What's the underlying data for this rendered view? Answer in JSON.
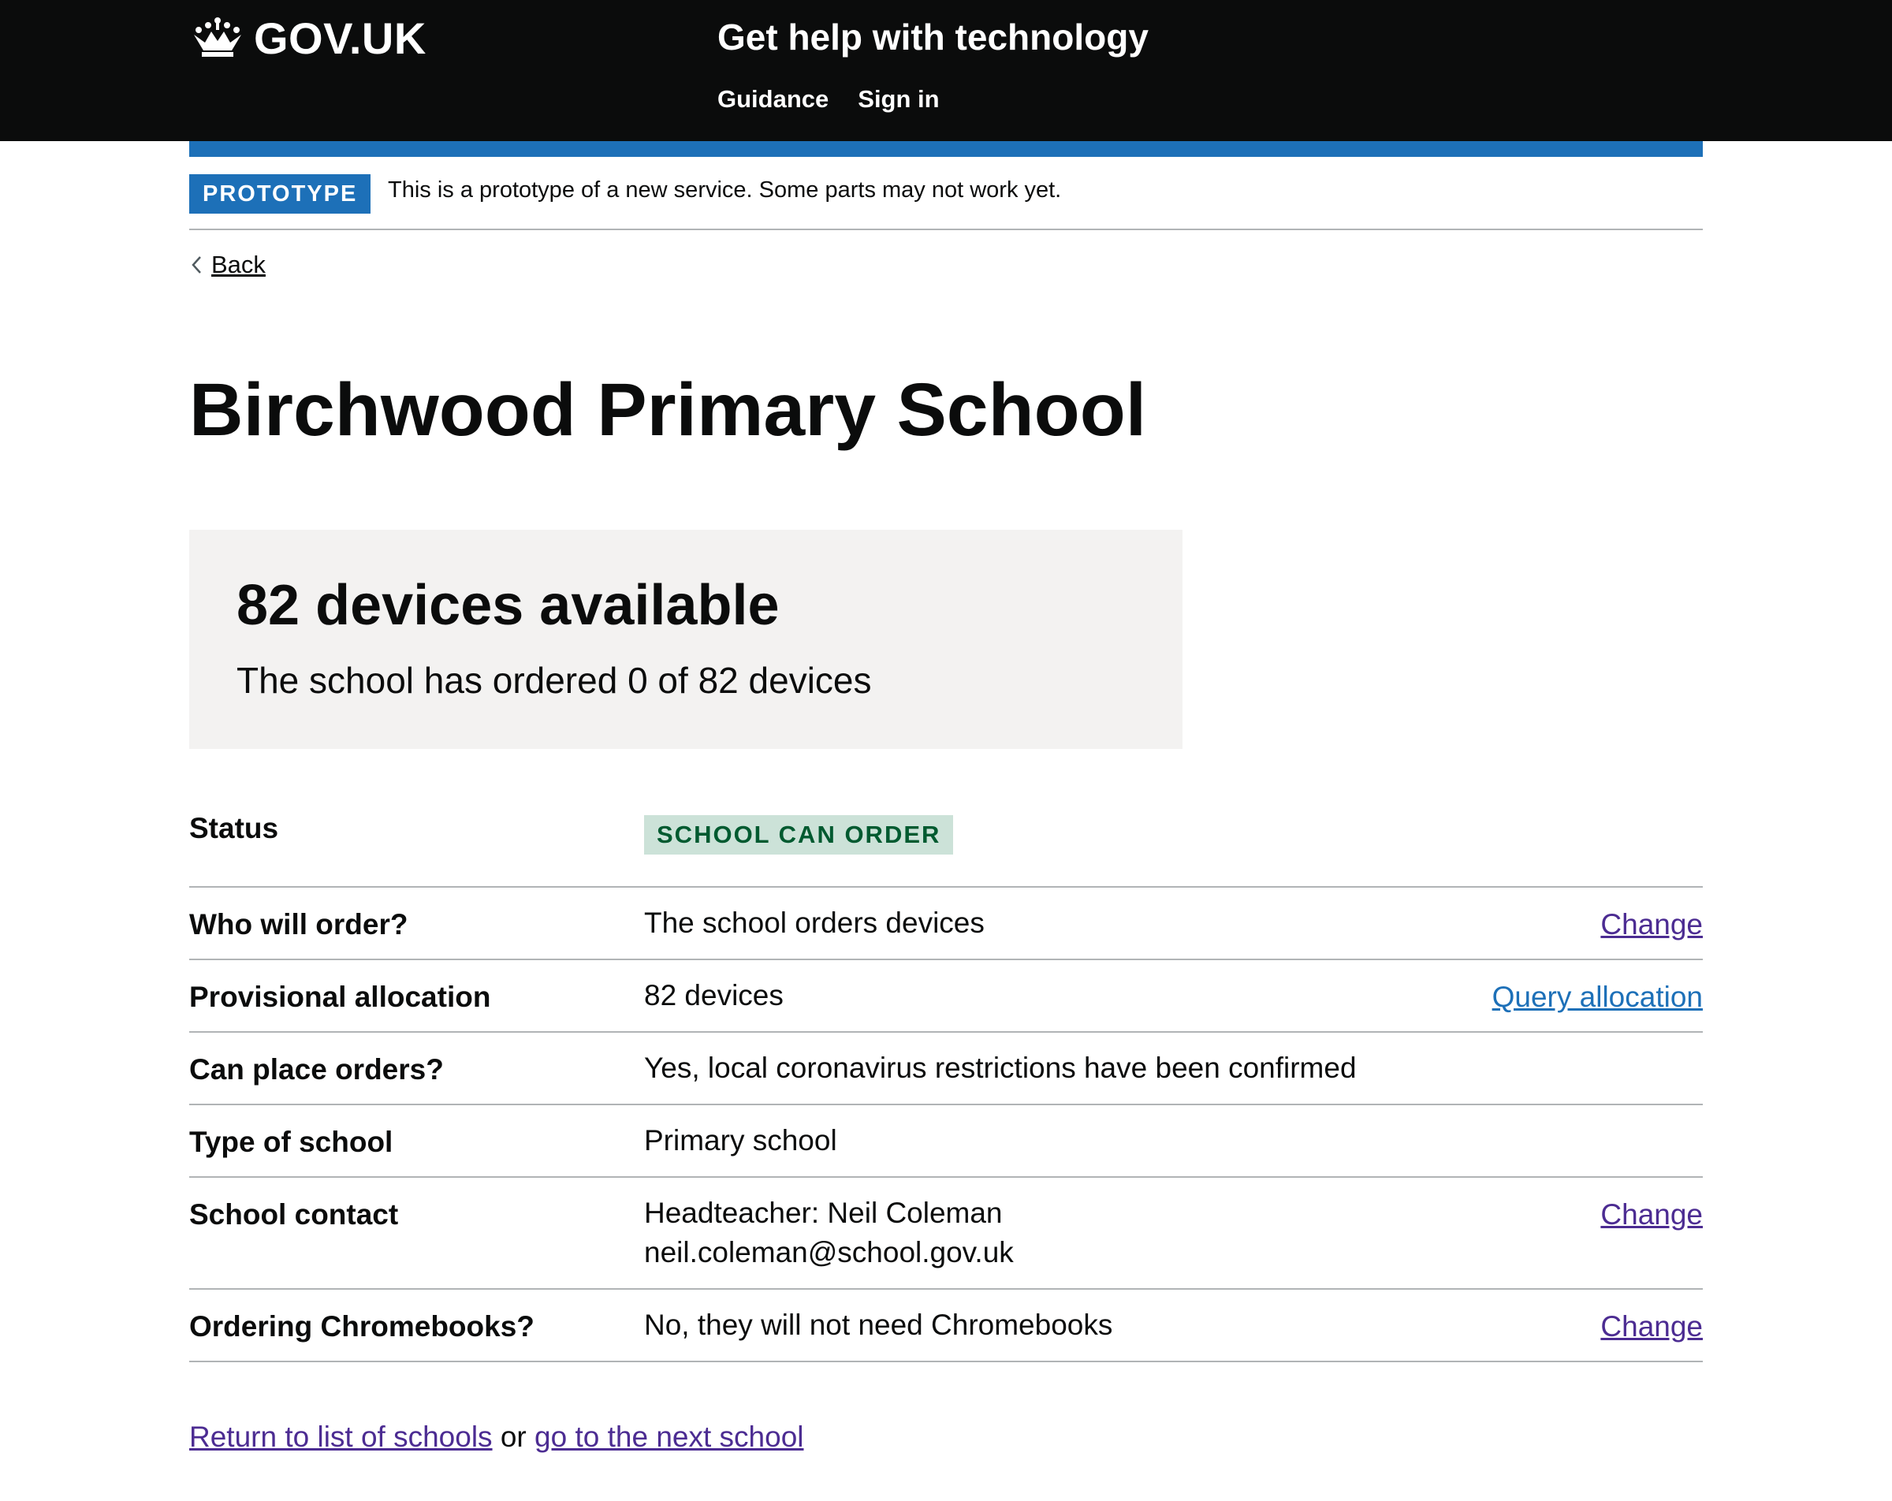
{
  "header": {
    "logo_text": "GOV.UK",
    "service_name": "Get help with technology",
    "nav": [
      "Guidance",
      "Sign in"
    ]
  },
  "phase_banner": {
    "tag": "PROTOTYPE",
    "text": "This is a prototype of a new service. Some parts may not work yet."
  },
  "back_link": "Back",
  "page_title": "Birchwood Primary School",
  "panel": {
    "heading": "82 devices available",
    "body": "The school has ordered 0 of 82 devices"
  },
  "summary": [
    {
      "key": "Status",
      "value": "SCHOOL CAN ORDER",
      "tag": true
    },
    {
      "key": "Who will order?",
      "value": "The school orders devices",
      "action": "Change"
    },
    {
      "key": "Provisional allocation",
      "value": "82 devices",
      "action": "Query allocation"
    },
    {
      "key": "Can place orders?",
      "value": "Yes, local coronavirus restrictions have been confirmed"
    },
    {
      "key": "Type of school",
      "value": "Primary school"
    },
    {
      "key": "School contact",
      "value_lines": [
        "Headteacher: Neil Coleman",
        "neil.coleman@school.gov.uk"
      ],
      "action": "Change"
    },
    {
      "key": "Ordering Chromebooks?",
      "value": "No, they will not need Chromebooks",
      "action": "Change"
    }
  ],
  "footer": {
    "link1": "Return to list of schools",
    "connector": "or",
    "link2": "go to the next school"
  },
  "colors": {
    "header_bg": "#0b0c0c",
    "brand_blue": "#1d70b8",
    "link_visited": "#4c2c92",
    "tag_green_bg": "#cce2d8",
    "tag_green_text": "#005a30",
    "panel_bg": "#f3f2f1",
    "border": "#b1b4b6"
  },
  "icons": {
    "logo": "crown-icon",
    "back": "chevron-left-icon"
  }
}
